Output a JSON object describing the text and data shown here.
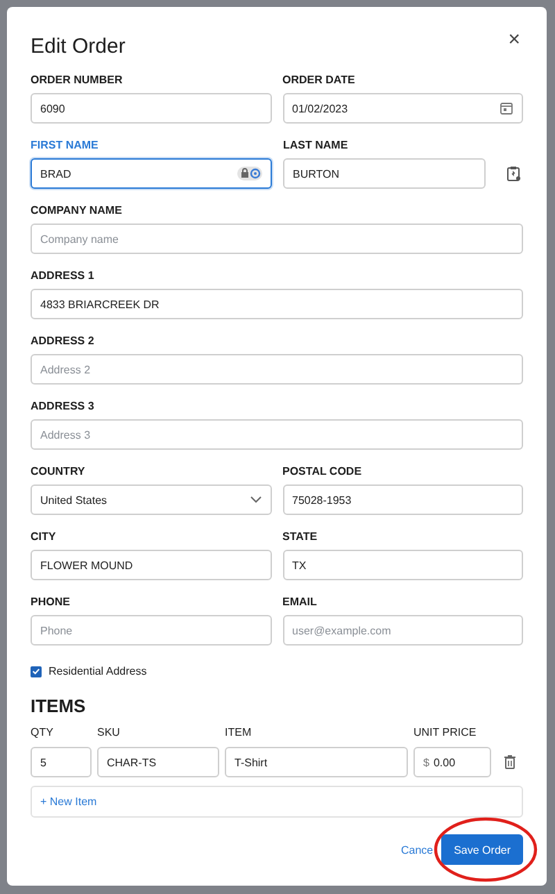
{
  "dialog": {
    "title": "Edit Order",
    "close": "×"
  },
  "rows": [
    {
      "kind": "pair",
      "fields": [
        {
          "label": "ORDER NUMBER",
          "value": "6090",
          "kind": "text",
          "focused": false
        },
        {
          "label": "ORDER DATE",
          "value": "01/02/2023",
          "kind": "date",
          "focused": false
        }
      ]
    },
    {
      "kind": "pair-action",
      "fields": [
        {
          "label": "FIRST NAME",
          "value": "BRAD",
          "kind": "autofill",
          "focused": true
        },
        {
          "label": "LAST NAME",
          "value": "BURTON",
          "kind": "text",
          "focused": false
        }
      ]
    },
    {
      "kind": "single",
      "fields": [
        {
          "label": "COMPANY NAME",
          "placeholder": "Company name",
          "kind": "text",
          "focused": false
        }
      ]
    },
    {
      "kind": "single",
      "fields": [
        {
          "label": "ADDRESS 1",
          "value": "4833 BRIARCREEK DR",
          "kind": "text",
          "focused": false
        }
      ]
    },
    {
      "kind": "single",
      "fields": [
        {
          "label": "ADDRESS 2",
          "placeholder": "Address 2",
          "kind": "text",
          "focused": false
        }
      ]
    },
    {
      "kind": "single",
      "fields": [
        {
          "label": "ADDRESS 3",
          "placeholder": "Address 3",
          "kind": "text",
          "focused": false
        }
      ]
    },
    {
      "kind": "pair",
      "fields": [
        {
          "label": "COUNTRY",
          "value": "United States",
          "kind": "select",
          "focused": false
        },
        {
          "label": "POSTAL CODE",
          "value": "75028-1953",
          "kind": "text",
          "focused": false
        }
      ]
    },
    {
      "kind": "pair",
      "fields": [
        {
          "label": "CITY",
          "value": "FLOWER MOUND",
          "kind": "text",
          "focused": false
        },
        {
          "label": "STATE",
          "value": "TX",
          "kind": "text",
          "focused": false
        }
      ]
    },
    {
      "kind": "pair",
      "fields": [
        {
          "label": "PHONE",
          "placeholder": "Phone",
          "kind": "text",
          "focused": false
        },
        {
          "label": "EMAIL",
          "placeholder": "user@example.com",
          "kind": "text",
          "focused": false
        }
      ]
    }
  ],
  "residential": {
    "label": "Residential Address",
    "checked": true
  },
  "items": {
    "title": "ITEMS",
    "columns": [
      "QTY",
      "SKU",
      "ITEM",
      "UNIT PRICE"
    ],
    "rows": [
      {
        "qty": "5",
        "sku": "CHAR-TS",
        "item": "T-Shirt",
        "currency": "$",
        "price": "0.00"
      }
    ],
    "add": "+ New Item"
  },
  "buttons": {
    "cancel": "Cance",
    "save": "Save Order"
  },
  "annotation": {
    "kind": "ellipse",
    "color": "#e0201b"
  }
}
